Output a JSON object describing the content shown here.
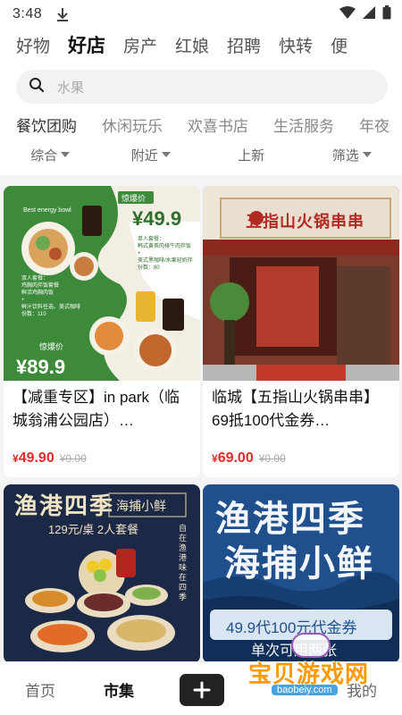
{
  "status_bar": {
    "time": "3:48"
  },
  "top_tabs": [
    {
      "label": "好物"
    },
    {
      "label": "好店",
      "active": true
    },
    {
      "label": "房产"
    },
    {
      "label": "红娘"
    },
    {
      "label": "招聘"
    },
    {
      "label": "快转"
    },
    {
      "label": "便"
    }
  ],
  "search": {
    "placeholder": "水果"
  },
  "sub_tabs": [
    {
      "label": "餐饮团购",
      "active": true
    },
    {
      "label": "休闲玩乐"
    },
    {
      "label": "欢喜书店"
    },
    {
      "label": "生活服务"
    },
    {
      "label": "年夜"
    }
  ],
  "filters": {
    "sort": "综合",
    "distance": "附近",
    "new": "上新",
    "filter": "筛选"
  },
  "cards": [
    {
      "title": "【减重专区】in park（临城翁浦公园店）…",
      "price": "49.90",
      "old_price": "0.00",
      "image": {
        "badge_top": "惊爆价",
        "price_top": "¥49.9",
        "desc_top": "单人套餐：\n韩式黄茶肉排牛肉拌饭\n+\n美式黑咖啡/水果轻奶拌\n份数：80",
        "desc_bottom": "双人套餐：\n鸡胸肉拌饭套餐\n鲜活鸡胸肉饭\n+\n鲜汁饮料任选、美式咖啡\n份数：110",
        "badge_bottom": "惊爆价",
        "price_bottom": "¥89.9",
        "corner_text": "Best energy bowl"
      }
    },
    {
      "title": "临城【五指山火锅串串】69抵100代金券…",
      "price": "69.00",
      "old_price": "0.00",
      "image": {
        "sign": "五指山火锅串串"
      }
    },
    {
      "title": "",
      "image": {
        "heading": "渔港四季",
        "tag": "海捕小鲜",
        "sub": "129元/桌  2人套餐",
        "side": "自在渔港 味在四季"
      }
    },
    {
      "title": "",
      "image": {
        "line1": "渔港四季",
        "line2": "海捕小鲜",
        "banner": "49.9代100元代金券",
        "banner2": "单次可用两张"
      }
    }
  ],
  "bottom_nav": {
    "home": "首页",
    "market": "市集",
    "mine": "我的"
  },
  "watermark": {
    "text": "宝贝游戏网",
    "url": "baobeiy.com"
  },
  "colors": {
    "price_red": "#e42a2a",
    "card1_green": "#3c8a3a",
    "card3_navy": "#1b2846",
    "card4_blue": "#1f4f8c"
  }
}
